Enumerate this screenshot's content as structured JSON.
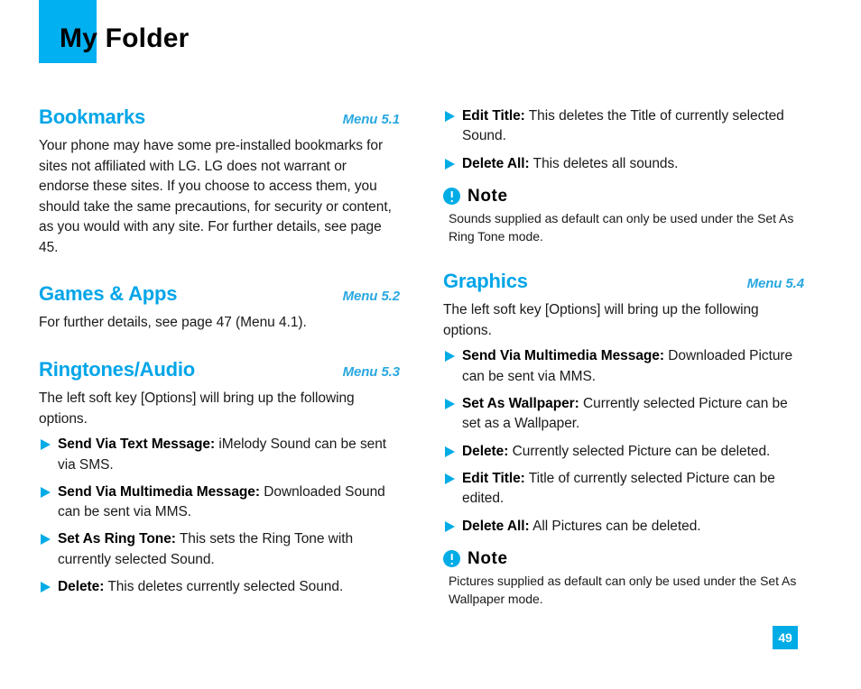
{
  "header": {
    "title": "My Folder",
    "swatch_color": "#00b0f0"
  },
  "theme": {
    "accent": "#00ace6",
    "heading_color": "#00a5e8",
    "menu_label_color": "#29a8e0",
    "text_color": "#1a1a1a"
  },
  "left_column": {
    "sections": [
      {
        "title": "Bookmarks",
        "menu": "Menu 5.1",
        "paragraph": "Your phone may have some pre-installed bookmarks for sites not affiliated with LG. LG does not warrant or endorse these sites. If you choose to access them, you should take the same precautions, for security or content, as you would with any site. For further details, see page 45."
      },
      {
        "title": "Games & Apps",
        "menu": "Menu 5.2",
        "paragraph": "For further details, see page 47 (Menu 4.1)."
      },
      {
        "title": "Ringtones/Audio",
        "menu": "Menu 5.3",
        "paragraph": "The left soft key [Options] will bring up the following options."
      }
    ],
    "bullets": [
      {
        "term": "Send Via Text Message:",
        "text": " iMelody Sound can be sent via SMS."
      },
      {
        "term": "Send Via Multimedia Message:",
        "text": " Downloaded Sound can be sent via MMS."
      },
      {
        "term": "Set As Ring Tone:",
        "text": " This sets the Ring Tone with currently selected Sound."
      },
      {
        "term": "Delete:",
        "text": " This deletes currently selected Sound."
      }
    ]
  },
  "right_column": {
    "bullets_top": [
      {
        "term": "Edit Title:",
        "text": " This deletes the Title of currently selected Sound."
      },
      {
        "term": "Delete All:",
        "text": " This deletes all sounds."
      }
    ],
    "note_top": {
      "label": "Note",
      "body": "Sounds supplied as default can only be used under the Set As Ring Tone mode."
    },
    "section": {
      "title": "Graphics",
      "menu": "Menu 5.4",
      "paragraph": "The left soft key [Options] will bring up the following options."
    },
    "bullets_bottom": [
      {
        "term": "Send Via Multimedia Message:",
        "text": " Downloaded Picture can be sent via MMS."
      },
      {
        "term": "Set As Wallpaper:",
        "text": " Currently selected Picture can be set as a Wallpaper."
      },
      {
        "term": "Delete:",
        "text": " Currently selected Picture can be deleted."
      },
      {
        "term": "Edit Title:",
        "text": " Title of currently selected Picture can be edited."
      },
      {
        "term": "Delete All:",
        "text": " All Pictures can be deleted."
      }
    ],
    "note_bottom": {
      "label": "Note",
      "body": "Pictures supplied as default can only be used under the Set As Wallpaper mode."
    }
  },
  "footer": {
    "page_number": "49"
  }
}
